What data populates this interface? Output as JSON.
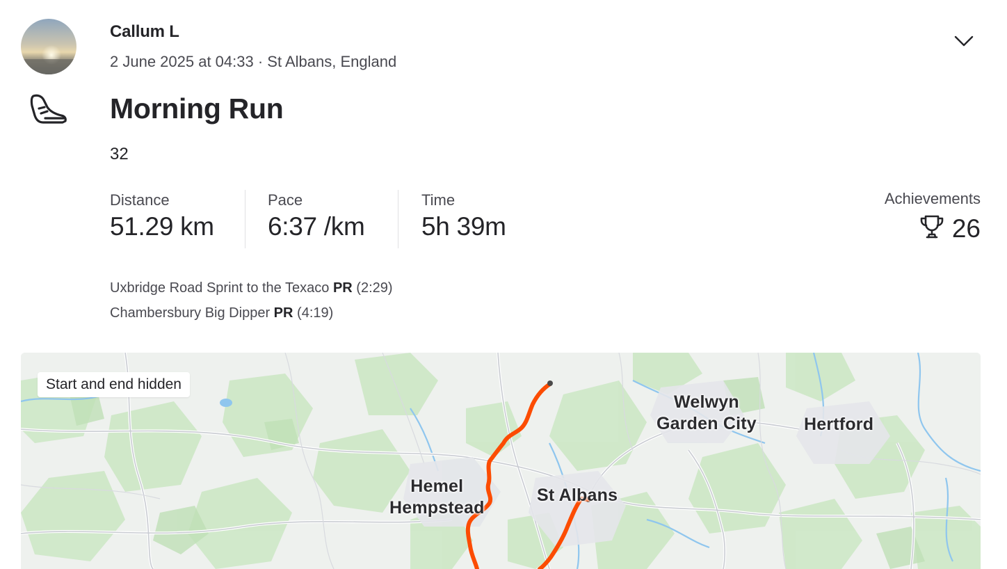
{
  "athlete": {
    "name": "Callum L",
    "meta": "2 June 2025 at 04:33 · St Albans, England"
  },
  "activity": {
    "sport_icon": "running-shoe-icon",
    "title": "Morning Run",
    "description": "32"
  },
  "stats": [
    {
      "label": "Distance",
      "value": "51.29 km"
    },
    {
      "label": "Pace",
      "value": "6:37 /km"
    },
    {
      "label": "Time",
      "value": "5h 39m"
    }
  ],
  "achievements": {
    "label": "Achievements",
    "icon": "trophy-icon",
    "count": "26"
  },
  "segments": [
    {
      "name": "Uxbridge Road Sprint to the Texaco",
      "badge": "PR",
      "time": "(2:29)"
    },
    {
      "name": "Chambersbury Big Dipper",
      "badge": "PR",
      "time": "(4:19)"
    }
  ],
  "map": {
    "badge": "Start and end hidden",
    "places": {
      "welwyn": "Welwyn\nGarden City",
      "hertford": "Hertford",
      "hemel": "Hemel\nHempstead",
      "stalbans": "St Albans"
    },
    "route_color": "#fc4c02"
  },
  "colors": {
    "accent": "#fc4c02",
    "text_primary": "#242428",
    "text_secondary": "#494950"
  }
}
